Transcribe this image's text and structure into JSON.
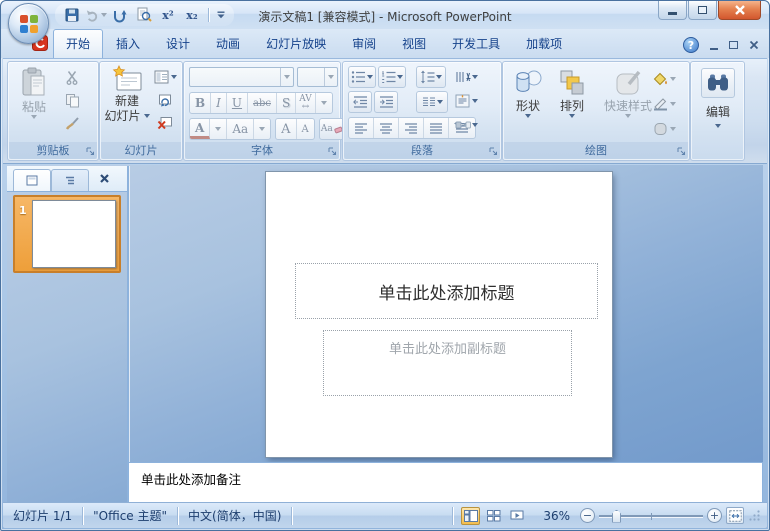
{
  "window": {
    "title": "演示文稿1 [兼容模式] - Microsoft PowerPoint",
    "help_glyph": "?"
  },
  "qat": {
    "superscript_label": "x²",
    "subscript_label": "x₂"
  },
  "tabs": {
    "active": "开始",
    "items": [
      {
        "label": "开始"
      },
      {
        "label": "插入"
      },
      {
        "label": "设计"
      },
      {
        "label": "动画"
      },
      {
        "label": "幻灯片放映"
      },
      {
        "label": "审阅"
      },
      {
        "label": "视图"
      },
      {
        "label": "开发工具"
      },
      {
        "label": "加载项"
      }
    ]
  },
  "ribbon": {
    "clipboard": {
      "group_label": "剪贴板",
      "paste_label": "粘贴"
    },
    "slides": {
      "group_label": "幻灯片",
      "new_slide_line1": "新建",
      "new_slide_line2": "幻灯片"
    },
    "font": {
      "group_label": "字体",
      "bold": "B",
      "italic": "I",
      "underline": "U",
      "strikethrough": "abc",
      "shadow": "S",
      "char_spacing": "AV",
      "spacing_arrow": "↔",
      "font_color": "A",
      "change_case": "Aa",
      "grow_font": "A",
      "shrink_font": "A",
      "clear_format": "Aa"
    },
    "paragraph": {
      "group_label": "段落"
    },
    "drawing": {
      "group_label": "绘图",
      "shapes_label": "形状",
      "arrange_label": "排列",
      "quick_styles_label": "快速样式"
    },
    "editing": {
      "button_label": "编辑"
    }
  },
  "slides_panel": {
    "slide_number": "1"
  },
  "slide": {
    "title_placeholder": "单击此处添加标题",
    "subtitle_placeholder": "单击此处添加副标题"
  },
  "notes": {
    "placeholder": "单击此处添加备注"
  },
  "status": {
    "slide_indicator": "幻灯片 1/1",
    "theme_name": "\"Office 主题\"",
    "language": "中文(简体，中国)",
    "zoom_level": "36%",
    "zoom_out_glyph": "−",
    "zoom_in_glyph": "+"
  },
  "colors": {
    "selection_orange": "#ee9f3a",
    "close_button_red": "#d2572e",
    "tab_text_blue": "#15428b",
    "editing_area_blue": "#7ea4d0"
  }
}
